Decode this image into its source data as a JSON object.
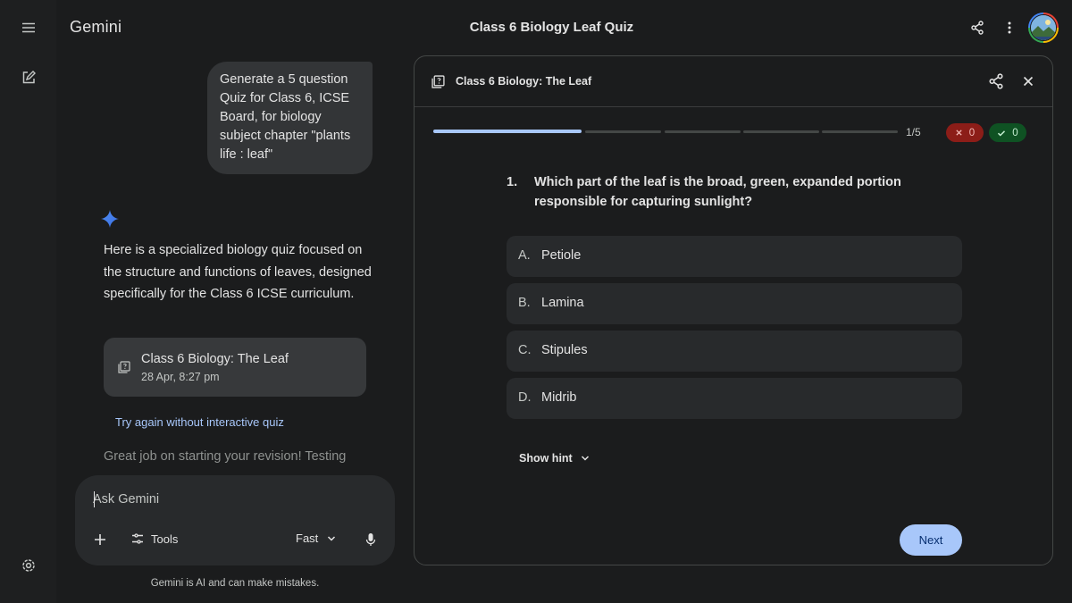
{
  "rail": {
    "menu_icon": "menu-icon",
    "new_chat_icon": "edit-square-icon",
    "settings_icon": "gear-icon"
  },
  "header": {
    "brand": "Gemini",
    "conversation_title": "Class 6 Biology Leaf Quiz",
    "share_icon": "share-icon",
    "more_icon": "more-vert-icon",
    "avatar_icon": "avatar"
  },
  "chat": {
    "user_message": "Generate a 5 question Quiz for Class 6, ICSE Board, for biology subject chapter \"plants life : leaf\"",
    "response_text": "Here is a specialized biology quiz focused on the structure and functions of leaves, designed specifically for the Class 6 ICSE curriculum.",
    "quiz_card": {
      "title": "Class 6 Biology: The Leaf",
      "date": "28 Apr, 8:27 pm"
    },
    "try_again": "Try again without interactive quiz",
    "followup_visible": "Great job on starting your revision! Testing"
  },
  "composer": {
    "placeholder": "Ask Gemini",
    "tools_label": "Tools",
    "mode_label": "Fast",
    "disclaimer": "Gemini is AI and can make mistakes."
  },
  "quiz_panel": {
    "title": "Class 6 Biology: The Leaf",
    "progress_counter": "1/5",
    "progress_fraction": 0.2,
    "wrong_count": "0",
    "correct_count": "0",
    "question_number": "1.",
    "question_text": "Which part of the leaf is the broad, green, expanded portion responsible for capturing sunlight?",
    "options": [
      {
        "letter": "A.",
        "label": "Petiole"
      },
      {
        "letter": "B.",
        "label": "Lamina"
      },
      {
        "letter": "C.",
        "label": "Stipules"
      },
      {
        "letter": "D.",
        "label": "Midrib"
      }
    ],
    "hint_label": "Show hint",
    "next_label": "Next"
  },
  "colors": {
    "background": "#1b1c1d",
    "accent": "#a8c7fa",
    "wrong_pill": "#8c1d18",
    "correct_pill": "#0f5223"
  }
}
